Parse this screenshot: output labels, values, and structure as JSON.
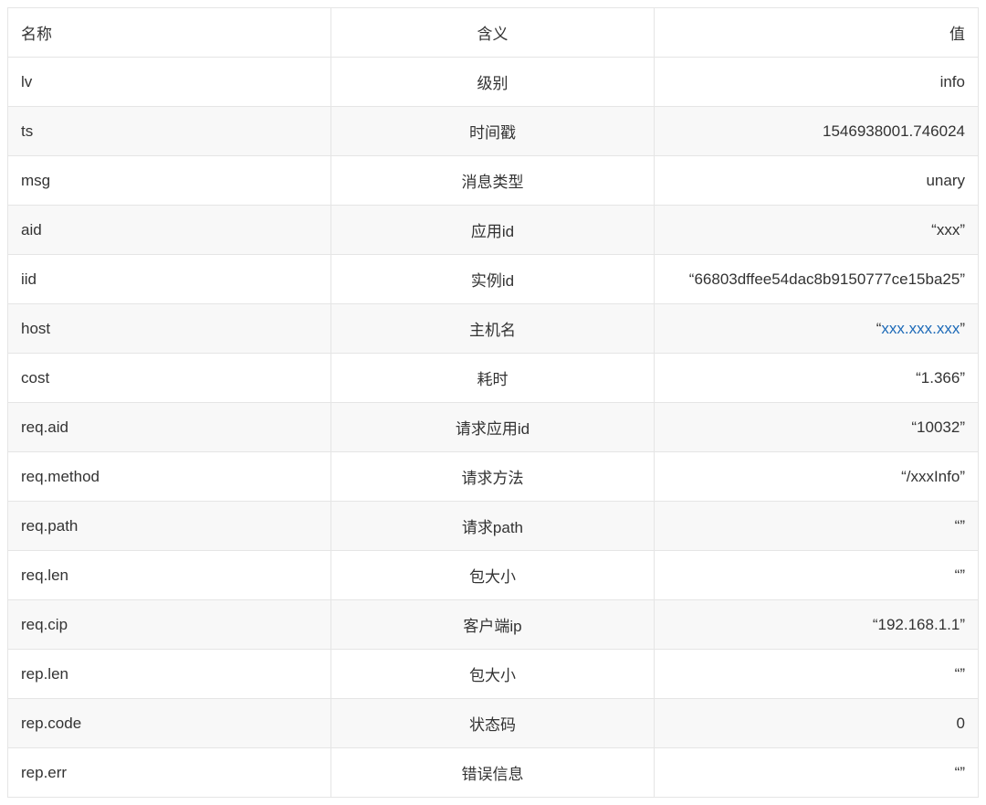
{
  "headers": {
    "name": "名称",
    "meaning": "含义",
    "value": "值"
  },
  "rows": [
    {
      "name": "lv",
      "meaning": "级别",
      "value": "info",
      "quoted": false,
      "link": null
    },
    {
      "name": "ts",
      "meaning": "时间戳",
      "value": "1546938001.746024",
      "quoted": false,
      "link": null
    },
    {
      "name": "msg",
      "meaning": "消息类型",
      "value": "unary",
      "quoted": false,
      "link": null
    },
    {
      "name": "aid",
      "meaning": "应用id",
      "value": "xxx",
      "quoted": true,
      "link": null
    },
    {
      "name": "iid",
      "meaning": "实例id",
      "value": "66803dffee54dac8b9150777ce15ba25",
      "quoted": true,
      "link": null
    },
    {
      "name": "host",
      "meaning": "主机名",
      "value": "xxx.xxx.xxx",
      "quoted": true,
      "link": "xxx.xxx.xxx"
    },
    {
      "name": "cost",
      "meaning": "耗时",
      "value": "1.366",
      "quoted": true,
      "link": null
    },
    {
      "name": "req.aid",
      "meaning": "请求应用id",
      "value": "10032",
      "quoted": true,
      "link": null
    },
    {
      "name": "req.method",
      "meaning": "请求方法",
      "value": "/xxxInfo",
      "quoted": true,
      "link": null
    },
    {
      "name": "req.path",
      "meaning": "请求path",
      "value": "",
      "quoted": true,
      "link": null
    },
    {
      "name": "req.len",
      "meaning": "包大小",
      "value": "",
      "quoted": true,
      "link": null
    },
    {
      "name": "req.cip",
      "meaning": "客户端ip",
      "value": "192.168.1.1",
      "quoted": true,
      "link": null
    },
    {
      "name": "rep.len",
      "meaning": "包大小",
      "value": "",
      "quoted": true,
      "link": null
    },
    {
      "name": "rep.code",
      "meaning": "状态码",
      "value": "0",
      "quoted": false,
      "link": null
    },
    {
      "name": "rep.err",
      "meaning": "错误信息",
      "value": "",
      "quoted": true,
      "link": null
    }
  ],
  "quote_open": "“",
  "quote_close": "”"
}
